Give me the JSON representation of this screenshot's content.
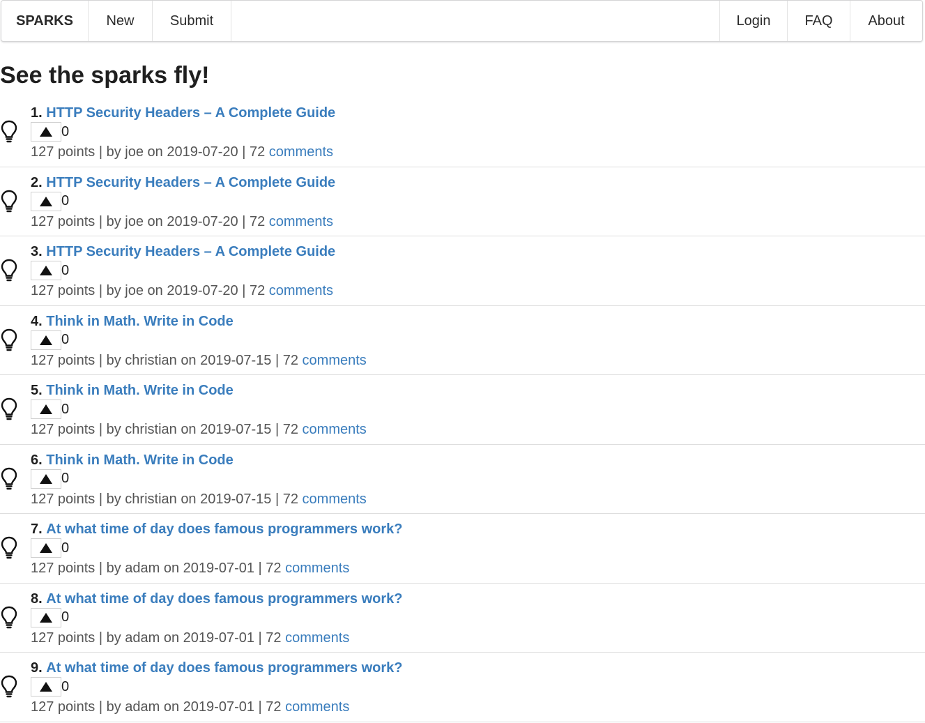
{
  "nav": {
    "brand": "SPARKS",
    "new": "New",
    "submit": "Submit",
    "login": "Login",
    "faq": "FAQ",
    "about": "About"
  },
  "page": {
    "title": "See the sparks fly!"
  },
  "colors": {
    "link": "#3a7dbd",
    "text": "#2b2b2b",
    "divider": "#dedede"
  },
  "stories": [
    {
      "rank": "1.",
      "title": "HTTP Security Headers – A Complete Guide",
      "votes": "0",
      "meta": "127 points | by joe on 2019-07-20 | 72 ",
      "comments": "comments"
    },
    {
      "rank": "2.",
      "title": "HTTP Security Headers – A Complete Guide",
      "votes": "0",
      "meta": "127 points | by joe on 2019-07-20 | 72 ",
      "comments": "comments"
    },
    {
      "rank": "3.",
      "title": "HTTP Security Headers – A Complete Guide",
      "votes": "0",
      "meta": "127 points | by joe on 2019-07-20 | 72 ",
      "comments": "comments"
    },
    {
      "rank": "4.",
      "title": "Think in Math. Write in Code",
      "votes": "0",
      "meta": "127 points | by christian on 2019-07-15 | 72 ",
      "comments": "comments"
    },
    {
      "rank": "5.",
      "title": "Think in Math. Write in Code",
      "votes": "0",
      "meta": "127 points | by christian on 2019-07-15 | 72 ",
      "comments": "comments"
    },
    {
      "rank": "6.",
      "title": "Think in Math. Write in Code",
      "votes": "0",
      "meta": "127 points | by christian on 2019-07-15 | 72 ",
      "comments": "comments"
    },
    {
      "rank": "7.",
      "title": "At what time of day does famous programmers work?",
      "votes": "0",
      "meta": "127 points | by adam on 2019-07-01 | 72 ",
      "comments": "comments"
    },
    {
      "rank": "8.",
      "title": "At what time of day does famous programmers work?",
      "votes": "0",
      "meta": "127 points | by adam on 2019-07-01 | 72 ",
      "comments": "comments"
    },
    {
      "rank": "9.",
      "title": "At what time of day does famous programmers work?",
      "votes": "0",
      "meta": "127 points | by adam on 2019-07-01 | 72 ",
      "comments": "comments"
    }
  ]
}
